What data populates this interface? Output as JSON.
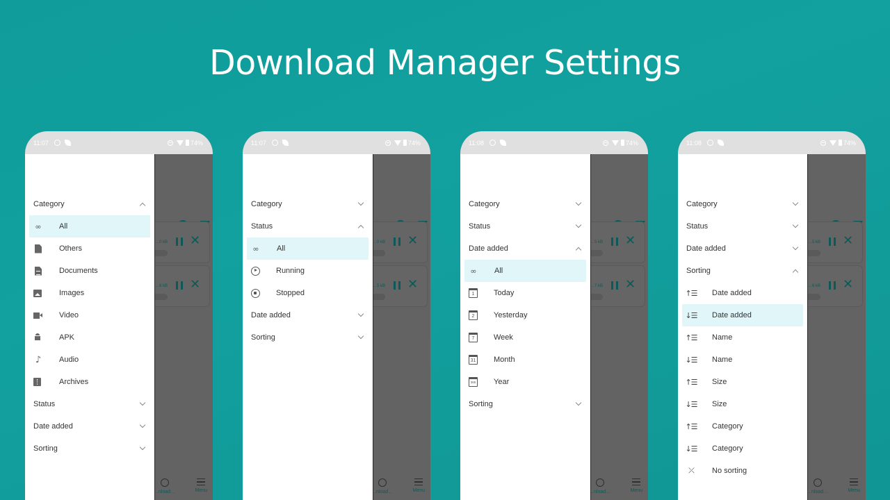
{
  "headline": "Download Manager Settings",
  "colors": {
    "background": "#12a19f",
    "selected_item_bg": "#e0f6f9",
    "accent_dark_teal": "#0b5a57",
    "status_bar": "#e0e0e0"
  },
  "phones": [
    {
      "status": {
        "time": "11:07",
        "battery": "74%"
      },
      "downloads": [
        {
          "size": "…0 kB"
        },
        {
          "size": "…6 kB"
        }
      ],
      "bottom_nav": {
        "downloads_label": "…nload…",
        "menu_label": "Menu"
      },
      "sections": {
        "category": {
          "label": "Category",
          "expanded": true,
          "items": [
            {
              "icon": "infinity-icon",
              "label": "All",
              "selected": true
            },
            {
              "icon": "file-icon",
              "label": "Others"
            },
            {
              "icon": "document-icon",
              "label": "Documents"
            },
            {
              "icon": "image-icon",
              "label": "Images"
            },
            {
              "icon": "video-icon",
              "label": "Video"
            },
            {
              "icon": "android-icon",
              "label": "APK"
            },
            {
              "icon": "music-note-icon",
              "label": "Audio"
            },
            {
              "icon": "archive-icon",
              "label": "Archives"
            }
          ]
        },
        "status": {
          "label": "Status",
          "expanded": false
        },
        "date_added": {
          "label": "Date added",
          "expanded": false
        },
        "sorting": {
          "label": "Sorting",
          "expanded": false
        }
      }
    },
    {
      "status": {
        "time": "11:07",
        "battery": "74%"
      },
      "downloads": [
        {
          "size": "…0 kB"
        },
        {
          "size": "…5 kB"
        }
      ],
      "bottom_nav": {
        "downloads_label": "…nload…",
        "menu_label": "Menu"
      },
      "sections": {
        "category": {
          "label": "Category",
          "expanded": false
        },
        "status": {
          "label": "Status",
          "expanded": true,
          "items": [
            {
              "icon": "infinity-icon",
              "label": "All",
              "selected": true
            },
            {
              "icon": "play-circle-icon",
              "label": "Running"
            },
            {
              "icon": "stop-circle-icon",
              "label": "Stopped"
            }
          ]
        },
        "date_added": {
          "label": "Date added",
          "expanded": false
        },
        "sorting": {
          "label": "Sorting",
          "expanded": false
        }
      }
    },
    {
      "status": {
        "time": "11:08",
        "battery": "74%"
      },
      "downloads": [
        {
          "size": "…5 kB"
        },
        {
          "size": "…7 kB"
        }
      ],
      "bottom_nav": {
        "downloads_label": "…nload…",
        "menu_label": "Menu"
      },
      "sections": {
        "category": {
          "label": "Category",
          "expanded": false
        },
        "status": {
          "label": "Status",
          "expanded": false
        },
        "date_added": {
          "label": "Date added",
          "expanded": true,
          "items": [
            {
              "icon": "infinity-icon",
              "label": "All",
              "selected": true
            },
            {
              "icon": "calendar-1-icon",
              "glyph": "1",
              "label": "Today"
            },
            {
              "icon": "calendar-2-icon",
              "glyph": "2",
              "label": "Yesterday"
            },
            {
              "icon": "calendar-7-icon",
              "glyph": "7",
              "label": "Week"
            },
            {
              "icon": "calendar-31-icon",
              "glyph": "31",
              "label": "Month"
            },
            {
              "icon": "calendar-365-icon",
              "glyph": "365",
              "label": "Year"
            }
          ]
        },
        "sorting": {
          "label": "Sorting",
          "expanded": false
        }
      }
    },
    {
      "status": {
        "time": "11:08",
        "battery": "74%"
      },
      "downloads": [
        {
          "size": "…5 kB"
        },
        {
          "size": "…6 kB"
        }
      ],
      "bottom_nav": {
        "downloads_label": "…nload…",
        "menu_label": "Menu"
      },
      "sections": {
        "category": {
          "label": "Category",
          "expanded": false
        },
        "status": {
          "label": "Status",
          "expanded": false
        },
        "date_added": {
          "label": "Date added",
          "expanded": false
        },
        "sorting": {
          "label": "Sorting",
          "expanded": true,
          "items": [
            {
              "icon": "sort-ascending-icon",
              "label": "Date added"
            },
            {
              "icon": "sort-descending-icon",
              "label": "Date added",
              "selected": true
            },
            {
              "icon": "sort-ascending-icon",
              "label": "Name"
            },
            {
              "icon": "sort-descending-icon",
              "label": "Name"
            },
            {
              "icon": "sort-ascending-icon",
              "label": "Size"
            },
            {
              "icon": "sort-descending-icon",
              "label": "Size"
            },
            {
              "icon": "sort-ascending-icon",
              "label": "Category"
            },
            {
              "icon": "sort-descending-icon",
              "label": "Category"
            },
            {
              "icon": "no-sort-icon",
              "label": "No sorting"
            }
          ]
        }
      }
    }
  ]
}
